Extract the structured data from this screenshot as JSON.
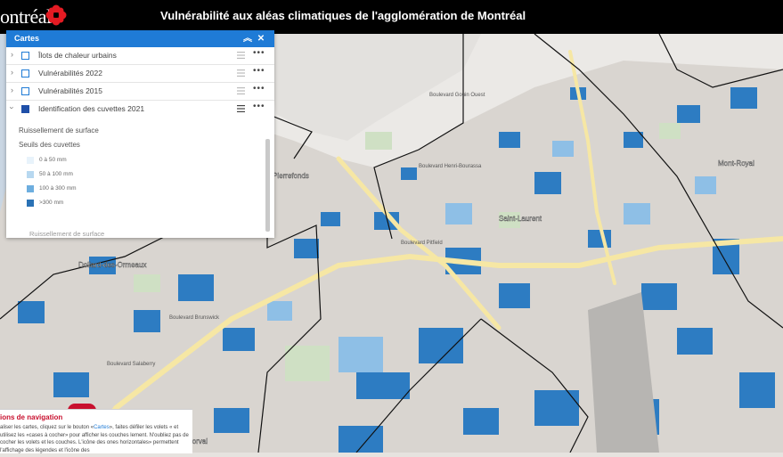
{
  "header": {
    "logo_text": "ontréal",
    "title": "Vulnérabilité aux aléas climatiques de l'agglomération de Montréal"
  },
  "map": {
    "place_labels": [
      "Mont-Royal",
      "Dollard-des-Ormeaux",
      "Pierrefonds",
      "Saint-Laurent",
      "Dorval"
    ],
    "street_labels": [
      "Boulevard Gouin Ouest",
      "Boulevard Henri-Bourassa",
      "Boulevard Pitfield",
      "Boulevard Brunswick",
      "Boulevard Salaberry"
    ],
    "colors": {
      "water_dark": "#2d7cc2",
      "water_light": "#8ebfe6",
      "park": "#cfe0c4",
      "road": "#f6e7a4",
      "base": "#dcd8d3"
    }
  },
  "panel": {
    "title": "Cartes",
    "layers": [
      {
        "label": "Îlots de chaleur urbains",
        "checked": false
      },
      {
        "label": "Vulnérabilités 2022",
        "checked": false
      },
      {
        "label": "Vulnérabilités 2015",
        "checked": false
      },
      {
        "label": "Identification des cuvettes 2021",
        "checked": true
      }
    ],
    "legend": {
      "title": "Ruissellement de surface",
      "subtitle": "Seuils des cuvettes",
      "items": [
        {
          "label": "0 à 50 mm",
          "color": "#e8f3fb"
        },
        {
          "label": "50 à 100 mm",
          "color": "#b7d8f0"
        },
        {
          "label": "100 à 300 mm",
          "color": "#6daedf"
        },
        {
          "label": ">300 mm",
          "color": "#2a72b5"
        }
      ]
    },
    "next_row_label": "Ruissellement de surface"
  },
  "nav": {
    "title": "ions de navigation",
    "text_pre": "aliser les cartes, cliquez sur le bouton «",
    "text_link": "Cartes",
    "text_post": "», faites défiler les volets « et utilisez les «cases à cocher» pour afficher les couches lement. N'oubliez pas de cocher les volets et les couches. L'icône des ones horizontales» permettent l'affichage des légendes et l'icône des"
  }
}
